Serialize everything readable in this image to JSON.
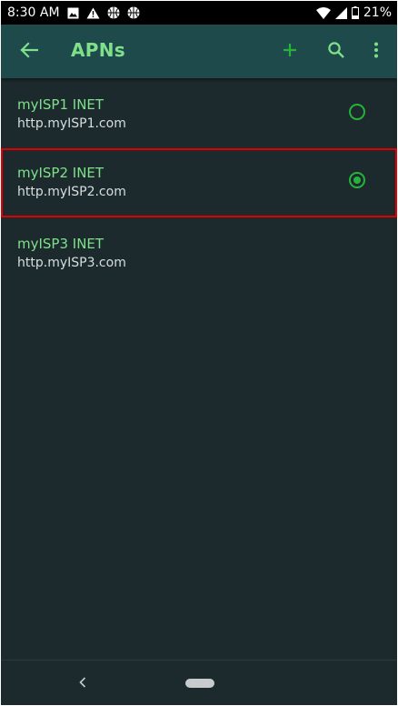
{
  "status_bar": {
    "time": "8:30 AM",
    "battery": "21%",
    "icons": [
      "image-icon",
      "warning-icon",
      "basketball-icon",
      "basketball-icon",
      "wifi-icon",
      "cell-signal-icon",
      "battery-icon"
    ]
  },
  "app_bar": {
    "title": "APNs",
    "back_icon": "back-arrow-icon",
    "actions": [
      "add-icon",
      "search-icon",
      "more-vert-icon"
    ]
  },
  "apns": [
    {
      "name": "myISP1 INET",
      "url": "http.myISP1.com",
      "selected": false
    },
    {
      "name": "myISP2 INET",
      "url": "http.myISP2.com",
      "selected": true
    },
    {
      "name": "myISP3 INET",
      "url": "http.myISP3.com",
      "selected": false
    }
  ],
  "colors": {
    "background": "#1c2a2d",
    "app_bar": "#1f4a4b",
    "accent": "#7fe08a",
    "radio": "#27b33b",
    "highlight_border": "#e00000"
  }
}
